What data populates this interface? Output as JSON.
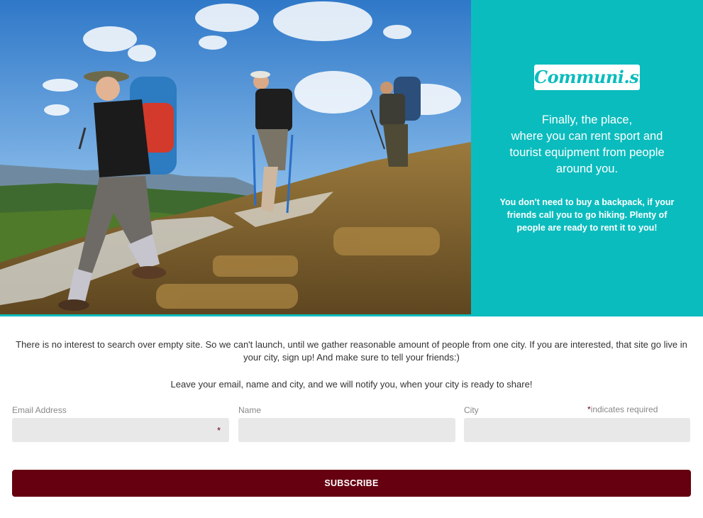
{
  "brand": {
    "logo": "Communi.st",
    "accent": "#0bbcbe",
    "button_color": "#660011"
  },
  "hero": {
    "image": "hikers-on-mountain-photo",
    "tagline": [
      "Finally, the place,",
      "where you can rent sport and",
      "tourist equipment from people",
      "around you."
    ],
    "subtext": "You don't need to buy a backpack, if your friends call you to go hiking. Plenty of people are ready to rent it to you!"
  },
  "intro": {
    "paragraph1": "There is no interest to search over empty site. So we can't launch, until we gather reasonable amount of people from one city. If you are interested, that site go live in your city, sign up! And make sure to tell your friends:)",
    "paragraph2": "Leave your email, name and city, and we will notify you, when your city is ready to share!"
  },
  "form": {
    "required_star": "*",
    "required_note": "indicates required",
    "fields": [
      {
        "label": "Email Address",
        "value": ""
      },
      {
        "label": "Name",
        "value": ""
      },
      {
        "label": "City",
        "value": ""
      }
    ],
    "submit_label": "SUBSCRIBE"
  }
}
